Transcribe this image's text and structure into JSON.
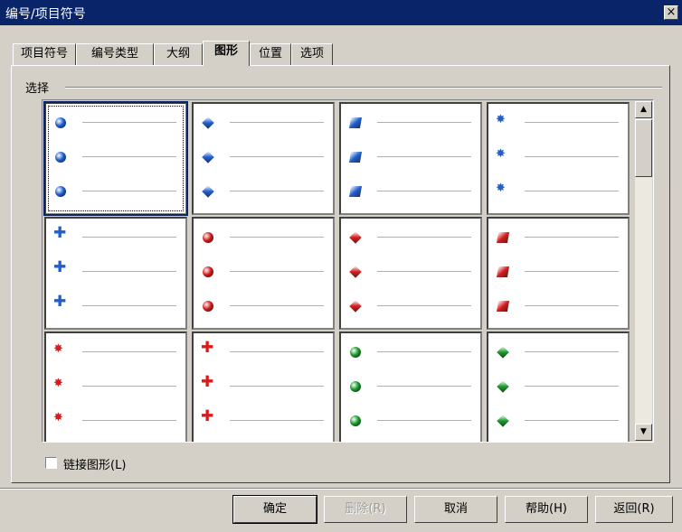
{
  "window": {
    "title": "编号/项目符号",
    "close_glyph": "×"
  },
  "tabs": [
    {
      "label": "项目符号"
    },
    {
      "label": "编号类型"
    },
    {
      "label": "大纲"
    },
    {
      "label": "图形",
      "active": true
    },
    {
      "label": "位置"
    },
    {
      "label": "选项"
    }
  ],
  "group": {
    "label": "选择"
  },
  "bullets": [
    {
      "shape": "sphere",
      "color": "#1f5fd0",
      "icon": "blue-sphere-icon",
      "selected": true
    },
    {
      "shape": "diamond",
      "color": "#1f5fd0",
      "icon": "blue-diamond-icon"
    },
    {
      "shape": "cube",
      "color": "#1f5fd0",
      "icon": "blue-cube-icon"
    },
    {
      "shape": "star",
      "color": "#1f5fd0",
      "icon": "blue-star-icon",
      "glyph": "✸"
    },
    {
      "shape": "plus",
      "color": "#1f5fd0",
      "icon": "blue-plus-icon",
      "glyph": "✚"
    },
    {
      "shape": "sphere",
      "color": "#d61c1c",
      "icon": "red-sphere-icon"
    },
    {
      "shape": "diamond",
      "color": "#d61c1c",
      "icon": "red-diamond-icon"
    },
    {
      "shape": "cube",
      "color": "#d61c1c",
      "icon": "red-cube-icon"
    },
    {
      "shape": "star",
      "color": "#d61c1c",
      "icon": "red-star-icon",
      "glyph": "✸"
    },
    {
      "shape": "plus",
      "color": "#d61c1c",
      "icon": "red-plus-icon",
      "glyph": "✚"
    },
    {
      "shape": "sphere",
      "color": "#1a9a2a",
      "icon": "green-sphere-icon"
    },
    {
      "shape": "diamond",
      "color": "#1a9a2a",
      "icon": "green-diamond-icon"
    }
  ],
  "checkbox": {
    "label": "链接图形(L)",
    "checked": false
  },
  "buttons": [
    {
      "label": "确定",
      "name": "ok-button",
      "default": true
    },
    {
      "label": "删除(R)",
      "name": "delete-button",
      "disabled": true
    },
    {
      "label": "取消",
      "name": "cancel-button"
    },
    {
      "label": "帮助(H)",
      "name": "help-button"
    },
    {
      "label": "返回(R)",
      "name": "reset-button"
    }
  ],
  "scrollbar": {
    "up_glyph": "▲",
    "down_glyph": "▼"
  }
}
